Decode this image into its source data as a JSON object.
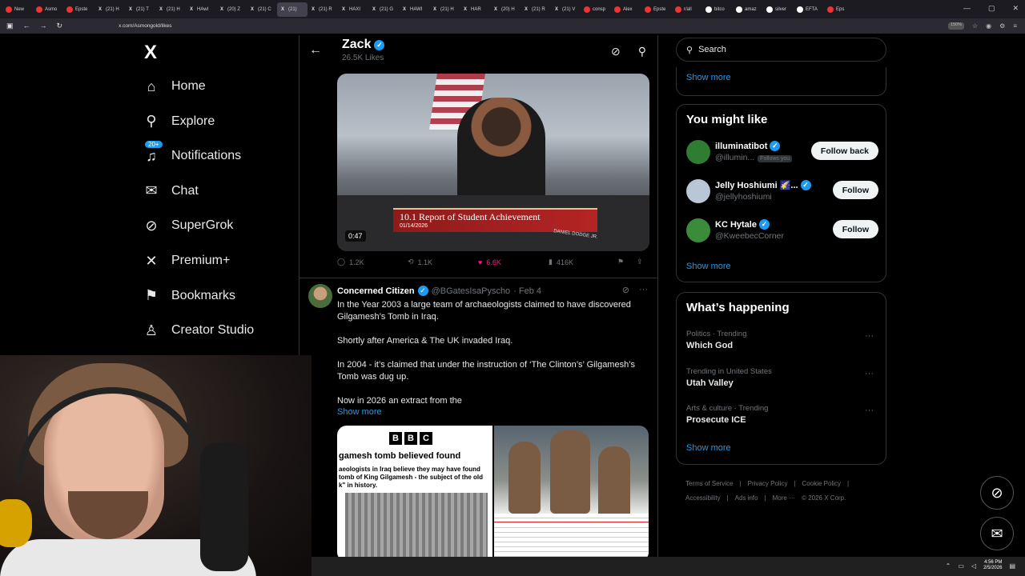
{
  "browser": {
    "tabs": [
      {
        "label": "New",
        "icon": "yt"
      },
      {
        "label": "Asmo",
        "icon": "yt"
      },
      {
        "label": "Epste",
        "icon": "yt"
      },
      {
        "label": "(21) H",
        "icon": "x"
      },
      {
        "label": "(21) T",
        "icon": "x"
      },
      {
        "label": "(21) H",
        "icon": "x"
      },
      {
        "label": "HAwI",
        "icon": "x"
      },
      {
        "label": "(20) Z",
        "icon": "x"
      },
      {
        "label": "(21) C",
        "icon": "x"
      },
      {
        "label": "(21)",
        "icon": "x"
      },
      {
        "label": "(21) R",
        "icon": "x"
      },
      {
        "label": "HAXI",
        "icon": "x"
      },
      {
        "label": "(21) G",
        "icon": "x"
      },
      {
        "label": "HAWI",
        "icon": "x"
      },
      {
        "label": "(21) H",
        "icon": "x"
      },
      {
        "label": "HAR",
        "icon": "x"
      },
      {
        "label": "(20) H",
        "icon": "x"
      },
      {
        "label": "(21) R",
        "icon": "x"
      },
      {
        "label": "(21) V",
        "icon": "x"
      },
      {
        "label": "consp",
        "icon": "yt"
      },
      {
        "label": "Alex",
        "icon": "yt"
      },
      {
        "label": "Epste",
        "icon": "yt"
      },
      {
        "label": "r/all",
        "icon": "yt"
      },
      {
        "label": "bitco",
        "icon": "web"
      },
      {
        "label": "amaz",
        "icon": "web"
      },
      {
        "label": "silver",
        "icon": "web"
      },
      {
        "label": "EFTA",
        "icon": "web"
      },
      {
        "label": "Eps",
        "icon": "yt"
      }
    ],
    "url": "x.com/Asmongold/likes",
    "zoom": "150%"
  },
  "sidebar": {
    "logo": "X",
    "items": [
      {
        "label": "Home",
        "icon": "home-icon",
        "glyph": "⌂"
      },
      {
        "label": "Explore",
        "icon": "search-icon",
        "glyph": "⚲"
      },
      {
        "label": "Notifications",
        "icon": "bell-icon",
        "glyph": "♫",
        "badge": "20+"
      },
      {
        "label": "Chat",
        "icon": "mail-icon",
        "glyph": "✉"
      },
      {
        "label": "SuperGrok",
        "icon": "grok-icon",
        "glyph": "⊘"
      },
      {
        "label": "Premium+",
        "icon": "x-icon",
        "glyph": "✕"
      },
      {
        "label": "Bookmarks",
        "icon": "bookmark-icon",
        "glyph": "⚑"
      },
      {
        "label": "Creator Studio",
        "icon": "creator-icon",
        "glyph": "♙"
      }
    ]
  },
  "header": {
    "name": "Zack",
    "likes": "26.5K Likes"
  },
  "video_tweet": {
    "chyron_title": "10.1 Report of Student Achievement",
    "chyron_date": "01/14/2026",
    "nameplate": "DANIEL DODGE JR.",
    "duration": "0:47",
    "replies": "1.2K",
    "reposts": "1.1K",
    "likes": "6.6K",
    "views": "416K"
  },
  "tweet2": {
    "name": "Concerned Citizen",
    "handle": "@BGatesIsaPyscho",
    "date": "· Feb 4",
    "paragraphs": [
      "In the Year 2003 a large team of archaeologists claimed to have discovered Gilgamesh’s Tomb in Iraq.",
      "Shortly after America & The UK invaded Iraq.",
      "In 2004 - it’s claimed that under the instruction of ‘The Clinton’s’ Gilgamesh’s Tomb was dug up.",
      "Now in 2026 an extract from the"
    ],
    "show_more": "Show more",
    "image1": {
      "bbc": [
        "B",
        "B",
        "C"
      ],
      "headline": "gamesh tomb believed found",
      "text": "aeologists in Iraq believe they may have found tomb of King Gilgamesh - the subject of the old k\" in history."
    }
  },
  "right": {
    "search_placeholder": "Search",
    "show_more_top": "Show more",
    "you_might_like": {
      "title": "You might like",
      "accounts": [
        {
          "name": "illuminatibot",
          "handle": "@illumin...",
          "follows_you": "Follows you",
          "button": "Follow back",
          "verified": true,
          "color": "#2e7d32"
        },
        {
          "name": "Jelly Hoshiumi 🌠...",
          "handle": "@jellyhoshiumi",
          "follows_you": "",
          "button": "Follow",
          "verified": true,
          "color": "#b8c6d6"
        },
        {
          "name": "KC Hytale",
          "handle": "@KweebecCorner",
          "follows_you": "",
          "button": "Follow",
          "verified": true,
          "color": "#3a8c3a"
        }
      ],
      "show_more": "Show more"
    },
    "whats_happening": {
      "title": "What’s happening",
      "trends": [
        {
          "context": "Politics · Trending",
          "name": "Which God"
        },
        {
          "context": "Trending in United States",
          "name": "Utah Valley"
        },
        {
          "context": "Arts & culture · Trending",
          "name": "Prosecute ICE"
        }
      ],
      "show_more": "Show more"
    },
    "footer": [
      "Terms of Service",
      "|",
      "Privacy Policy",
      "|",
      "Cookie Policy",
      "|",
      "Accessibility",
      "|",
      "Ads info",
      "|",
      "More ···",
      "© 2026 X Corp."
    ]
  },
  "taskbar": {
    "time": "4:56 PM",
    "date": "2/5/2026"
  }
}
